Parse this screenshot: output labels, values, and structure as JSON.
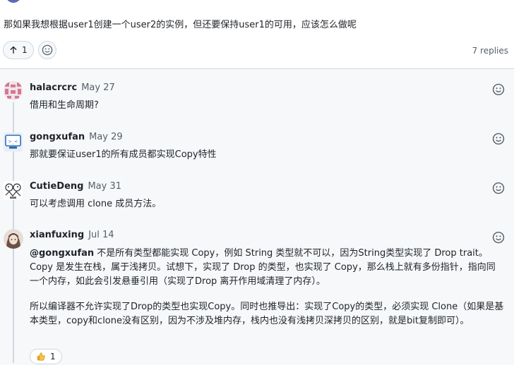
{
  "question": {
    "text": "那如果我想根据user1创建一个user2的实例，但还要保持user1的可用，应该怎么做呢"
  },
  "reactions": {
    "upvote_count": "1"
  },
  "replies_label": "7 replies",
  "comments": [
    {
      "author": "halacrcrc",
      "date": "May 27",
      "body": "借用和生命周期?"
    },
    {
      "author": "gongxufan",
      "date": "May 29",
      "body": "那就要保证user1的所有成员都实现Copy特性"
    },
    {
      "author": "CutieDeng",
      "date": "May 31",
      "body": "可以考虑调用 clone 成员方法。"
    },
    {
      "author": "xianfuxing",
      "date": "Jul 14",
      "mention": "@gongxufan",
      "body_p1_rest": " 不是所有类型都能实现 Copy，例如 String 类型就不可以，因为String类型实现了 Drop trait。Copy 是发生在栈，属于浅拷贝。试想下，实现了 Drop 的类型，也实现了 Copy，那么栈上就有多份指针，指向同一个内存，如此会引发悬垂引用（实现了Drop 离开作用域清理了内存）。",
      "body_p2": "所以编译器不允许实现了Drop的类型也实现Copy。同时也推导出：实现了Copy的类型，必须实现 Clone（如果是基本类型，copy和clone没有区别，因为不涉及堆内存，栈内也没有浅拷贝深拷贝的区别，就是bit复制即可）。",
      "reaction_count": "1"
    }
  ],
  "icons": {
    "upvote": "arrow-up-icon",
    "emoji": "smiley-icon",
    "thumbs": "thumbs-up-icon"
  }
}
